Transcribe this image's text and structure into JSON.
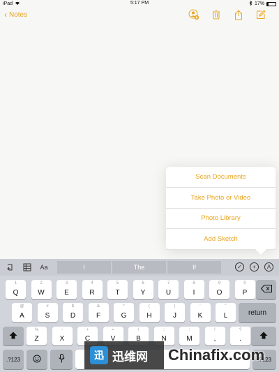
{
  "status_bar": {
    "device": "iPad",
    "time": "5:17 PM",
    "battery_text": "17%",
    "battery_level": 0.17
  },
  "nav": {
    "back_label": "Notes"
  },
  "colors": {
    "accent": "#e9a521",
    "keyboard_bg": "#d1d4da"
  },
  "popover": {
    "items": [
      "Scan Documents",
      "Take Photo or Video",
      "Photo Library",
      "Add Sketch"
    ]
  },
  "keyboard": {
    "suggestions": [
      "I",
      "The",
      "If"
    ],
    "format_label": "Aa",
    "row1": [
      {
        "sub": "1",
        "main": "Q"
      },
      {
        "sub": "2",
        "main": "W"
      },
      {
        "sub": "3",
        "main": "E"
      },
      {
        "sub": "4",
        "main": "R"
      },
      {
        "sub": "5",
        "main": "T"
      },
      {
        "sub": "6",
        "main": "Y"
      },
      {
        "sub": "7",
        "main": "U"
      },
      {
        "sub": "8",
        "main": "I"
      },
      {
        "sub": "9",
        "main": "O"
      },
      {
        "sub": "0",
        "main": "P"
      }
    ],
    "row2": [
      {
        "sub": "@",
        "main": "A"
      },
      {
        "sub": "#",
        "main": "S"
      },
      {
        "sub": "$",
        "main": "D"
      },
      {
        "sub": "&",
        "main": "F"
      },
      {
        "sub": "*",
        "main": "G"
      },
      {
        "sub": "(",
        "main": "H"
      },
      {
        "sub": ")",
        "main": "J"
      },
      {
        "sub": "'",
        "main": "K"
      },
      {
        "sub": "\"",
        "main": "L"
      }
    ],
    "row3": [
      {
        "sub": "%",
        "main": "Z"
      },
      {
        "sub": "-",
        "main": "X"
      },
      {
        "sub": "+",
        "main": "C"
      },
      {
        "sub": "=",
        "main": "V"
      },
      {
        "sub": "/",
        "main": "B"
      },
      {
        "sub": ";",
        "main": "N"
      },
      {
        "sub": ":",
        "main": "M"
      },
      {
        "sub": "!",
        "main": ","
      },
      {
        "sub": "?",
        "main": "."
      }
    ],
    "return_label": "return",
    "numbers_label": ".?123"
  },
  "watermark": {
    "logo_text": "迅维网",
    "site_text": "Chinafix.com"
  }
}
